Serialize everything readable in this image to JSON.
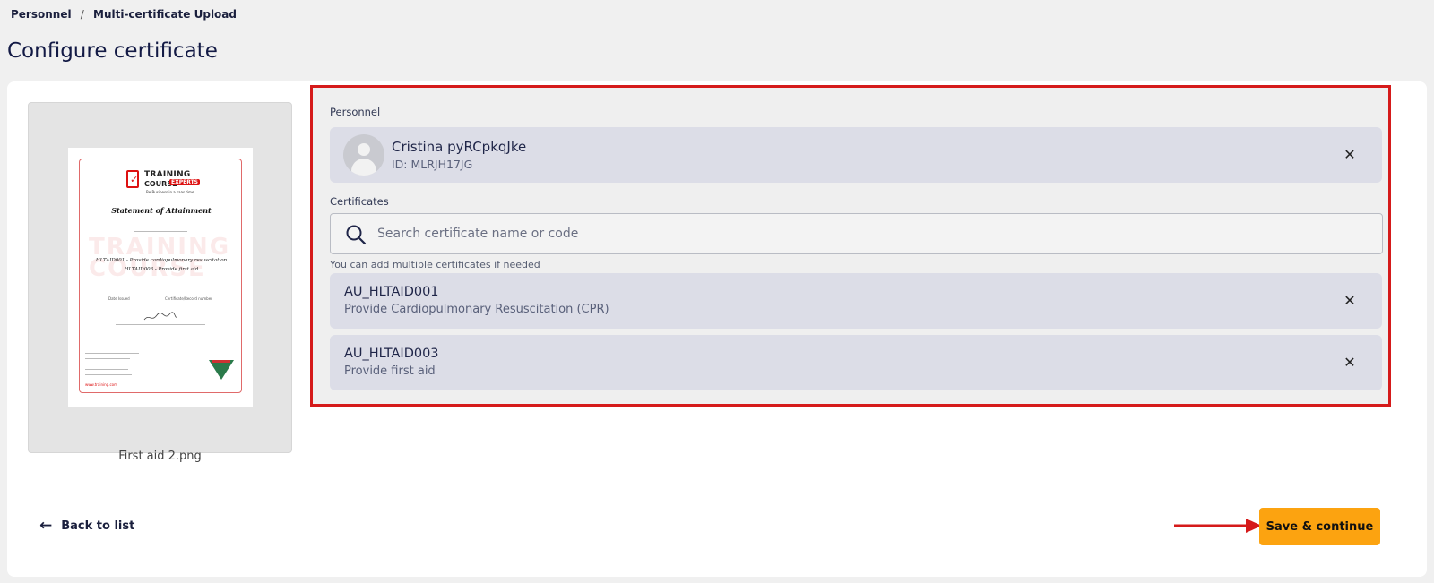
{
  "breadcrumb": {
    "root": "Personnel",
    "separator": "/",
    "current": "Multi-certificate Upload"
  },
  "page": {
    "title": "Configure certificate"
  },
  "preview": {
    "file_name": "First aid 2.png",
    "document": {
      "logo_line1": "TRAINING",
      "logo_line2": "COURSE",
      "logo_badge": "EXPERTS",
      "logo_tagline": "Be Business in a saas time",
      "title": "Statement of Attainment",
      "unit1": "HLTAID001 - Provide cardiopulmonary resuscitation",
      "unit2": "HLTAID003 - Provide first aid",
      "date_issued": "Date Issued",
      "cert_number": "Certificate/Record number",
      "website": "www.training.com"
    }
  },
  "form": {
    "personnel_label": "Personnel",
    "person": {
      "name": "Cristina pyRCpkqJke",
      "id": "ID: MLRJH17JG"
    },
    "certificates_label": "Certificates",
    "search": {
      "placeholder": "Search certificate name or code"
    },
    "hint": "You can add multiple certificates if needed",
    "certificates": [
      {
        "code": "AU_HLTAID001",
        "name": "Provide Cardiopulmonary Resuscitation (CPR)"
      },
      {
        "code": "AU_HLTAID003",
        "name": "Provide first aid"
      }
    ],
    "remove_glyph": "✕"
  },
  "footer": {
    "back_label": "Back to list",
    "back_icon": "arrow-left-icon",
    "save_label": "Save & continue"
  },
  "colors": {
    "accent": "#fca310",
    "highlight_border": "#d51a1a",
    "chip_bg": "#dcdde7",
    "title": "#131a45"
  }
}
